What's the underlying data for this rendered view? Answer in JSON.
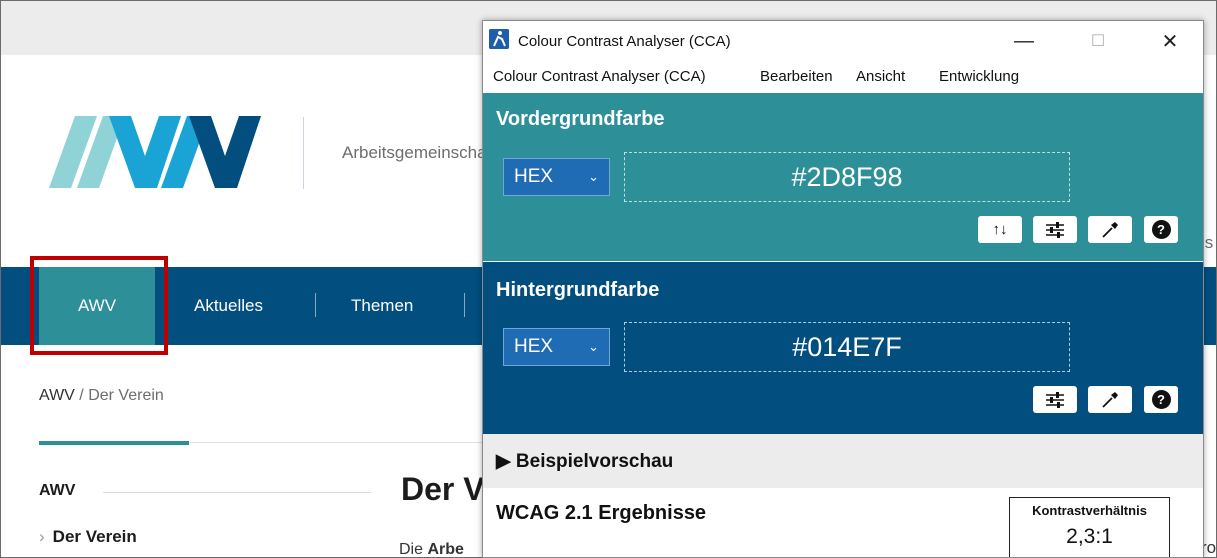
{
  "website": {
    "org_name": "Arbeitsgemeinschaft",
    "nav": {
      "active": "AWV",
      "items": [
        "Aktuelles",
        "Themen"
      ]
    },
    "breadcrumb": {
      "home": "AWV",
      "separator": " / ",
      "current": "Der Verein"
    },
    "sidebar": {
      "heading": "AWV",
      "link": "Der Verein"
    },
    "main": {
      "title_fragment": "Der V",
      "text_prefix": "Die ",
      "text_bold": "Arbe"
    },
    "edge_fragments": [
      "is",
      "ro"
    ],
    "colors": {
      "nav": "#014e7f",
      "accent": "#2d8f98",
      "highlight": "#c00000"
    }
  },
  "cca": {
    "window_title": "Colour Contrast Analyser (CCA)",
    "window_controls": {
      "minimize": "—",
      "maximize": "☐",
      "close": "✕"
    },
    "menu": [
      "Colour Contrast Analyser (CCA)",
      "Bearbeiten",
      "Ansicht",
      "Entwicklung"
    ],
    "foreground": {
      "title": "Vordergrundfarbe",
      "format": "HEX",
      "value": "#2D8F98",
      "color": "#2d8f98",
      "tools": [
        "swap-icon",
        "sliders-icon",
        "eyedropper-icon",
        "help-icon"
      ]
    },
    "background": {
      "title": "Hintergrundfarbe",
      "format": "HEX",
      "value": "#014E7F",
      "color": "#014e7f",
      "tools": [
        "sliders-icon",
        "eyedropper-icon",
        "help-icon"
      ]
    },
    "preview": {
      "label": "Beispielvorschau",
      "toggle": "▶"
    },
    "results": {
      "title": "WCAG 2.1 Ergebnisse",
      "ratio_label": "Kontrastverhältnis",
      "ratio_value": "2,3:1"
    }
  }
}
